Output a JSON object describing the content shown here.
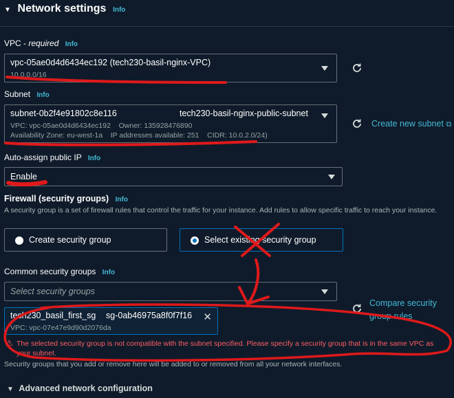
{
  "header": {
    "title": "Network settings",
    "info": "Info"
  },
  "vpc": {
    "label": "VPC - ",
    "required": "required",
    "info": "Info",
    "value": "vpc-05ae0d4d6434ec192 (tech230-basil-nginx-VPC)",
    "cidr": "10.0.0.0/16"
  },
  "subnet": {
    "label": "Subnet",
    "info": "Info",
    "id": "subnet-0b2f4e91802c8e116",
    "name": "tech230-basil-nginx-public-subnet",
    "vpc_owner": "VPC: vpc-05ae0d4d6434ec192    Owner: 135928476890",
    "details": "Availability Zone: eu-west-1a    IP addresses available: 251    CIDR: 10.0.2.0/24)",
    "create_link": "Create new subnet"
  },
  "public_ip": {
    "label": "Auto-assign public IP",
    "info": "Info",
    "value": "Enable"
  },
  "firewall": {
    "label": "Firewall (security groups)",
    "info": "Info",
    "description": "A security group is a set of firewall rules that control the traffic for your instance. Add rules to allow specific traffic to reach your instance.",
    "option_create": "Create security group",
    "option_existing": "Select existing security group"
  },
  "common_sg": {
    "label": "Common security groups",
    "info": "Info",
    "placeholder": "Select security groups",
    "token_name": "tech230_basil_first_sg",
    "token_id": "sg-0ab46975a8f0f7f16",
    "token_vpc": "VPC: vpc-07e47e9d90d2076da",
    "compare_link_line1": "Compare security",
    "compare_link_line2": "group rules"
  },
  "error": {
    "line1": "The selected security group is not compatible with the subnet specified. Please specify a security group that is in the same VPC as",
    "line2": "your subnet."
  },
  "footer_note": "Security groups that you add or remove here will be added to or removed from all your network interfaces.",
  "advanced": {
    "label": "Advanced network configuration"
  },
  "colors": {
    "background": "#0f1b2a",
    "link": "#44b9d6",
    "error": "#ff5d64",
    "annotation": "#e0191b"
  }
}
